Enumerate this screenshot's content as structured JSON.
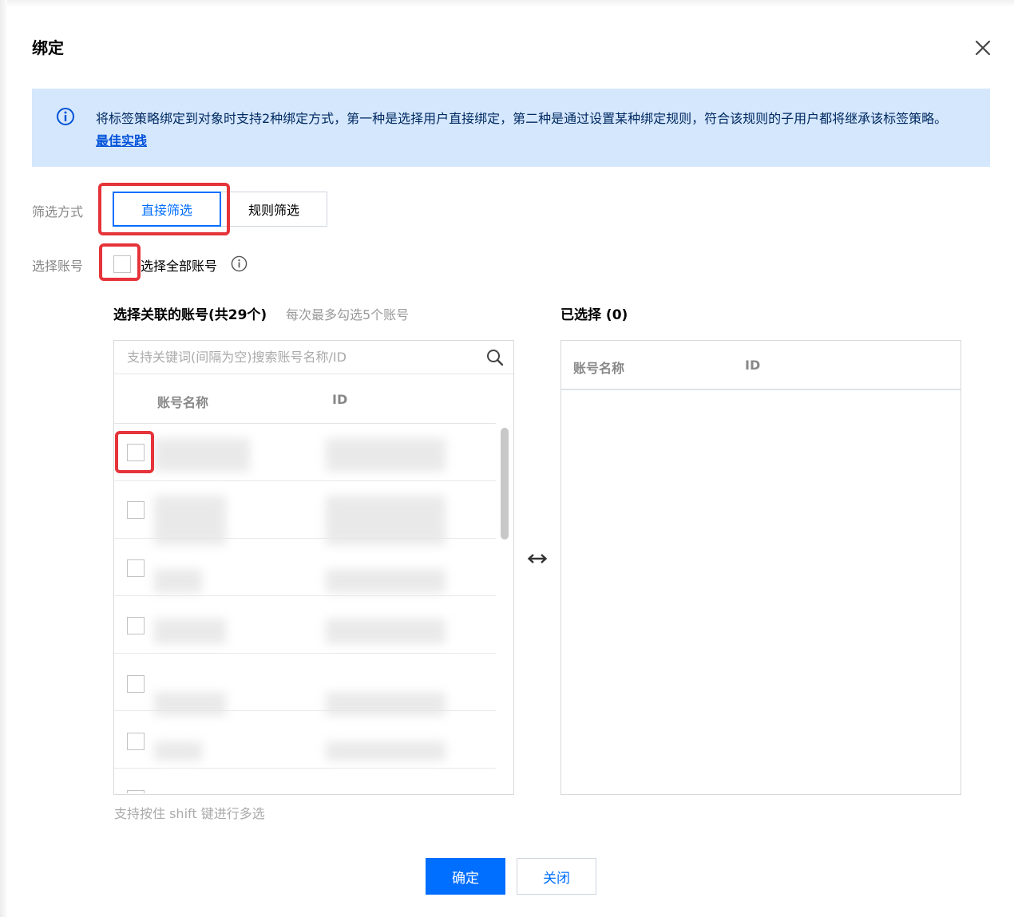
{
  "dialog": {
    "title": "绑定",
    "close_icon": "close-icon"
  },
  "notice": {
    "icon": "info-icon",
    "text": "将标签策略绑定到对象时支持2种绑定方式，第一种是选择用户直接绑定，第二种是通过设置某种绑定规则，符合该规则的子用户都将继承该标签策略。",
    "link_label": "最佳实践"
  },
  "filter": {
    "label": "筛选方式",
    "options": [
      "直接筛选",
      "规则筛选"
    ],
    "selected": "直接筛选"
  },
  "select_account": {
    "label": "选择账号",
    "checkbox_label": "选择全部账号",
    "info_icon": "info-circle-icon"
  },
  "left_panel": {
    "title": "选择关联的账号(共29个)",
    "hint": "每次最多勾选5个账号",
    "search_placeholder": "支持关键词(间隔为空)搜索账号名称/ID",
    "search_icon": "search-icon",
    "columns": [
      "账号名称",
      "ID"
    ]
  },
  "right_panel": {
    "title": "已选择 (0)",
    "columns": [
      "账号名称",
      "ID"
    ]
  },
  "transfer_icon": "left-right-arrow-icon",
  "footer_hint": "支持按住 shift 键进行多选",
  "buttons": {
    "confirm": "确定",
    "close": "关闭"
  },
  "colors": {
    "primary": "#006eff",
    "notice_bg": "#d5e7fd",
    "highlight": "#e5343a"
  }
}
